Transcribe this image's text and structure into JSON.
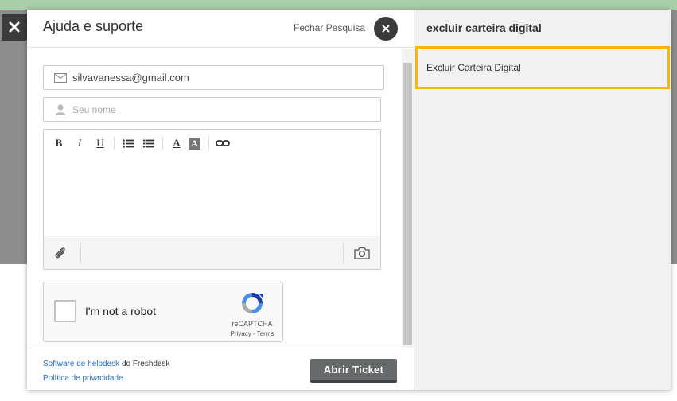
{
  "widget": {
    "title": "Ajuda e suporte",
    "close_search_label": "Fechar Pesquisa"
  },
  "form": {
    "email_value": "silvavanessa@gmail.com",
    "name_placeholder": "Seu nome",
    "toolbar": {
      "bold": "B",
      "italic": "I",
      "underline": "U",
      "font_color": "A",
      "bg_color": "A"
    }
  },
  "captcha": {
    "label": "I'm not a robot",
    "brand": "reCAPTCHA",
    "terms": "Privacy - Terms"
  },
  "footer": {
    "credit_link": "Software de helpdesk",
    "credit_suffix": " do Freshdesk",
    "privacy_link": "Política de privacidade",
    "submit_label": "Abrir Ticket"
  },
  "search_panel": {
    "query": "excluir carteira digital",
    "results": [
      "Excluir Carteira Digital"
    ]
  },
  "colors": {
    "accent_highlight": "#f5b800",
    "link": "#2a6ebb",
    "button": "#666a6b"
  }
}
